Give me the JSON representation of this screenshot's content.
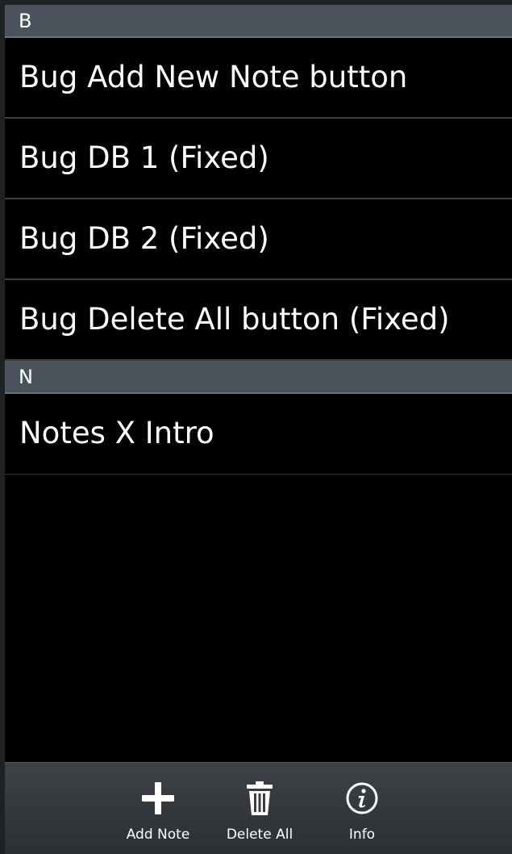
{
  "sections": [
    {
      "header": "B",
      "items": [
        "Bug Add New Note button",
        "Bug DB 1 (Fixed)",
        "Bug DB 2 (Fixed)",
        "Bug Delete All button (Fixed)"
      ]
    },
    {
      "header": "N",
      "items": [
        "Notes X Intro"
      ]
    }
  ],
  "action_bar": {
    "add_note": {
      "label": "Add Note",
      "icon": "plus-icon"
    },
    "delete_all": {
      "label": "Delete All",
      "icon": "trash-icon"
    },
    "info": {
      "label": "Info",
      "icon": "info-icon"
    }
  },
  "colors": {
    "background": "#000000",
    "section_header": "#4a535b",
    "action_bar": "#3a3d41"
  }
}
